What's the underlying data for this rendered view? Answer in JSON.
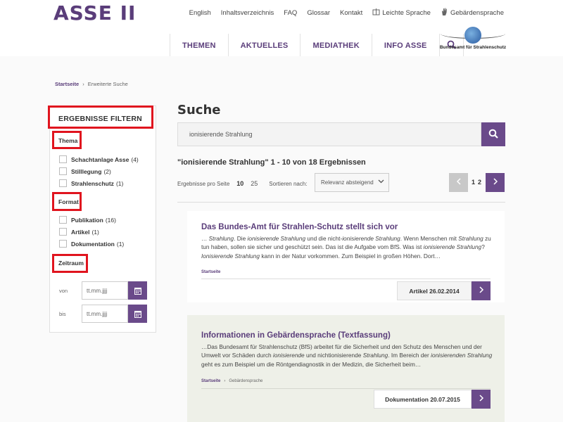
{
  "header": {
    "logo": "ASSE II",
    "topnav": [
      {
        "label": "English",
        "icon": ""
      },
      {
        "label": "Inhaltsverzeichnis",
        "icon": ""
      },
      {
        "label": "FAQ",
        "icon": ""
      },
      {
        "label": "Glossar",
        "icon": ""
      },
      {
        "label": "Kontakt",
        "icon": ""
      },
      {
        "label": "Leichte Sprache",
        "icon": "book-icon"
      },
      {
        "label": "Gebärdensprache",
        "icon": "hand-icon"
      }
    ],
    "mainnav": [
      "THEMEN",
      "AKTUELLES",
      "MEDIATHEK",
      "INFO ASSE"
    ],
    "bfs_label": "Bundesamt für Strahlenschutz"
  },
  "breadcrumb": {
    "home": "Startseite",
    "sep": "›",
    "current": "Erweiterte Suche"
  },
  "sidebar": {
    "title": "ERGEBNISSE FILTERN",
    "thema": {
      "title": "Thema",
      "items": [
        {
          "label": "Schachtanlage Asse",
          "count": "(4)"
        },
        {
          "label": "Stilllegung",
          "count": "(2)"
        },
        {
          "label": "Strahlenschutz",
          "count": "(1)"
        }
      ]
    },
    "format": {
      "title": "Format",
      "items": [
        {
          "label": "Publikation",
          "count": "(16)"
        },
        {
          "label": "Artikel",
          "count": "(1)"
        },
        {
          "label": "Dokumentation",
          "count": "(1)"
        }
      ]
    },
    "zeitraum": {
      "title": "Zeitraum",
      "von_label": "von",
      "bis_label": "bis",
      "placeholder": "tt.mm.jjjj"
    }
  },
  "main": {
    "heading": "Suche",
    "search_value": "ionisierende Strahlung",
    "results_summary": "\"ionisierende Strahlung\" 1 - 10 von 18 Ergebnissen",
    "per_page_label": "Ergebnisse pro Seite",
    "per_page_options": [
      "10",
      "25"
    ],
    "sort_label": "Sortieren nach:",
    "sort_value": "Relevanz absteigend",
    "pages": [
      "1",
      "2"
    ],
    "results": [
      {
        "title": "Das Bundes-Amt für Strahlen-Schutz stellt sich vor",
        "snippet_parts": [
          "… ",
          "Strahlung",
          ". Die ",
          "ionisierende Strahlung",
          " und die nicht-",
          "ionisierende Strahlung",
          ". Wenn Menschen mit ",
          "Strahlung",
          " zu tun haben, sollen sie sicher und geschützt sein. Das ist die Aufgabe vom BfS. Was ist ",
          "ionisierende Strahlung",
          "? ",
          "Ionisierende Strahlung",
          " kann in der Natur vorkommen. Zum Beispiel in großen Höhen. Dort…"
        ],
        "source": [
          "Startseite"
        ],
        "tag": "Artikel 26.02.2014"
      },
      {
        "title": "Informationen in Gebärdensprache (Textfassung)",
        "snippet_parts": [
          "…Das Bundesamt für Strahlenschutz (BfS) arbeitet für die Sicherheit und den Schutz des Menschen und der Umwelt vor Schäden durch ",
          "ionisierende",
          " und nichtionisierende ",
          "Strahlung",
          ". Im Bereich der ",
          "ionisierenden Strahlung",
          " geht es zum Beispiel um die Röntgendiagnostik in der Medizin, die Sicherheit beim…"
        ],
        "source": [
          "Startseite",
          "Gebärdensprache"
        ],
        "tag": "Dokumentation 20.07.2015"
      }
    ]
  },
  "colors": {
    "brand": "#5a3d7a",
    "button": "#6a4a8a",
    "highlight_box": "#e0141e"
  }
}
